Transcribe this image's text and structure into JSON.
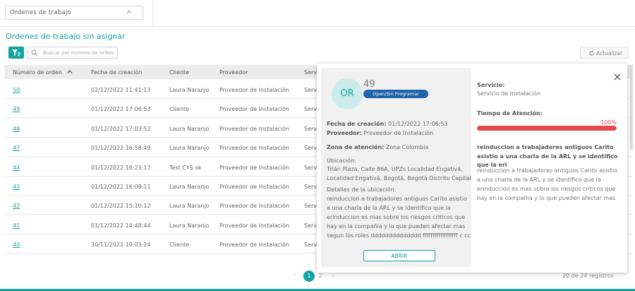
{
  "filter": {
    "selected": "Ordenes de trabajo"
  },
  "section_title": "Ordenes de trabajo sin asignar",
  "search": {
    "placeholder": "Buscar por número de orden"
  },
  "refresh_label": "Actualizar",
  "table": {
    "columns": [
      "Número de orden",
      "Fecha de creación",
      "Cliente",
      "Proveedor",
      "Servi"
    ],
    "rows": [
      [
        "50",
        "02/12/2022 11:41:13",
        "Laura Naranjo",
        "Proveedor de Instalación",
        "Servi"
      ],
      [
        "49",
        "01/12/2022 17:06:53",
        "Cliente",
        "Proveedor de Instalación",
        "Servi"
      ],
      [
        "48",
        "01/12/2022 17:03:52",
        "Laura Naranjo",
        "Proveedor de Instalación",
        "Servi"
      ],
      [
        "47",
        "01/12/2022 16:58:49",
        "Laura Naranjo",
        "Proveedor de Instalación",
        "Servi"
      ],
      [
        "44",
        "01/12/2022 16:23:17",
        "Test CYS ok",
        "Proveedor de Instalación",
        "Servi"
      ],
      [
        "43",
        "01/12/2022 16:08:11",
        "Laura Naranjo",
        "Proveedor de Instalación",
        "Servi"
      ],
      [
        "42",
        "01/12/2022 15:10:12",
        "Laura Naranjo",
        "Proveedor de Instalación",
        "Servi"
      ],
      [
        "41",
        "01/12/2022 14:48:44",
        "Laura Naranjo",
        "Proveedor de Instalación",
        "Servi"
      ],
      [
        "40",
        "30/11/2022 19:03:24",
        "Cliente",
        "Proveedor de Instalación",
        "Servi"
      ]
    ]
  },
  "pagination": {
    "pages": [
      "1",
      "2"
    ],
    "current": "1",
    "records": "20 de 24 registros"
  },
  "popup": {
    "avatar": "OR",
    "order_number": "49",
    "status": "Open/Sin Programar",
    "fecha_label": "Fecha de creación:",
    "fecha_value": "01/12/2022 17:06:53",
    "proveedor_label": "Proveedor:",
    "proveedor_value": "Proveedor de Instalación",
    "zona_label": "Zona de atención:",
    "zona_value": "Zona Colombia",
    "ubicacion_label": "Ubicación:",
    "ubicacion_value": "Titán Plaza, Calle 86A, UPZs Localidad Engativá, Localidad Engativá, Bogotá, Bogotá Distrito Capital",
    "detalles_label": "Detalles de la ubicación:",
    "detalles_value": "reinduccion a trabajadores antiguos Carito asistio a una charla de la ARL y se identifico que la erinduccion es mas sobre los riesgos criticos que hay en la compañia y lo que pueden afectar mas segun los roles dddddddddddddd ffffffffffffffffff c cc",
    "abrir_label": "ABRIR",
    "servicio_label": "Servicio:",
    "servicio_value": "Servicio de Instalación",
    "tiempo_label": "Tiempo de Atención:",
    "tiempo_pct_label": "100%",
    "tiempo_fraction": 1.0,
    "desc_title": "reinduccion a trabajadores antiguos Carito asistio a una charla de la ARL y se identifico que la eri",
    "desc_body": "reinduccion a trabajadores antiguos Carito asistio a una charla de la ARL y se identifico que la erinduccion es mas sobre los riesgos criticos que hay en la compañia y lo que pueden afectar mas"
  },
  "colors": {
    "accent": "#15a3a1",
    "status_badge": "#1f63a8",
    "progress": "#e64b4b"
  }
}
